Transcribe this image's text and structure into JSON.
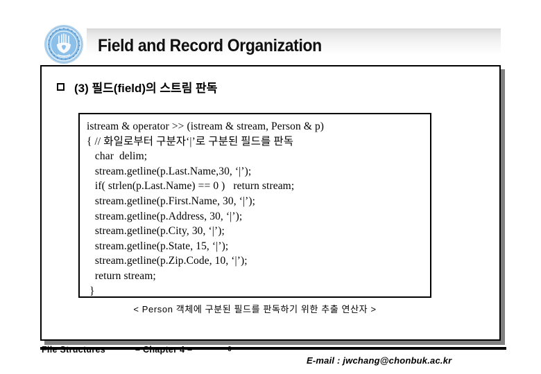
{
  "header": {
    "title": "Field and Record Organization",
    "logo_name": "chonbuk-university-seal"
  },
  "heading": {
    "bullet": "square-bullet",
    "text": "(3) 필드(field)의 스트림 판독"
  },
  "code": {
    "lines": [
      "istream & operator >> (istream & stream, Person & p)",
      "{ // 화일로부터 구분자‘|’로 구분된 필드를 판독",
      "   char  delim;",
      "   stream.getline(p.Last.Name,30, ‘|’);",
      "   if( strlen(p.Last.Name) == 0 )   return stream;",
      "   stream.getline(p.First.Name, 30, ‘|’);",
      "   stream.getline(p.Address, 30, ‘|’);",
      "   stream.getline(p.City, 30, ‘|’);",
      "   stream.getline(p.State, 15, ‘|’);",
      "   stream.getline(p.Zip.Code, 10, ‘|’);",
      "   return stream;",
      " }"
    ]
  },
  "caption": {
    "text": "< Person 객체에 구분된 필드를 판독하기 위한 추출 연산자 >"
  },
  "footer": {
    "course": "File Structures",
    "chapter": "– Chapter 4 –",
    "page": "- 6 -",
    "email": "E-mail : jwchang@chonbuk.ac.kr"
  },
  "colors": {
    "seal_blue": "#5b9bd5",
    "seal_light": "#bcd9f0",
    "border": "#000000",
    "shadow": "#808080"
  }
}
